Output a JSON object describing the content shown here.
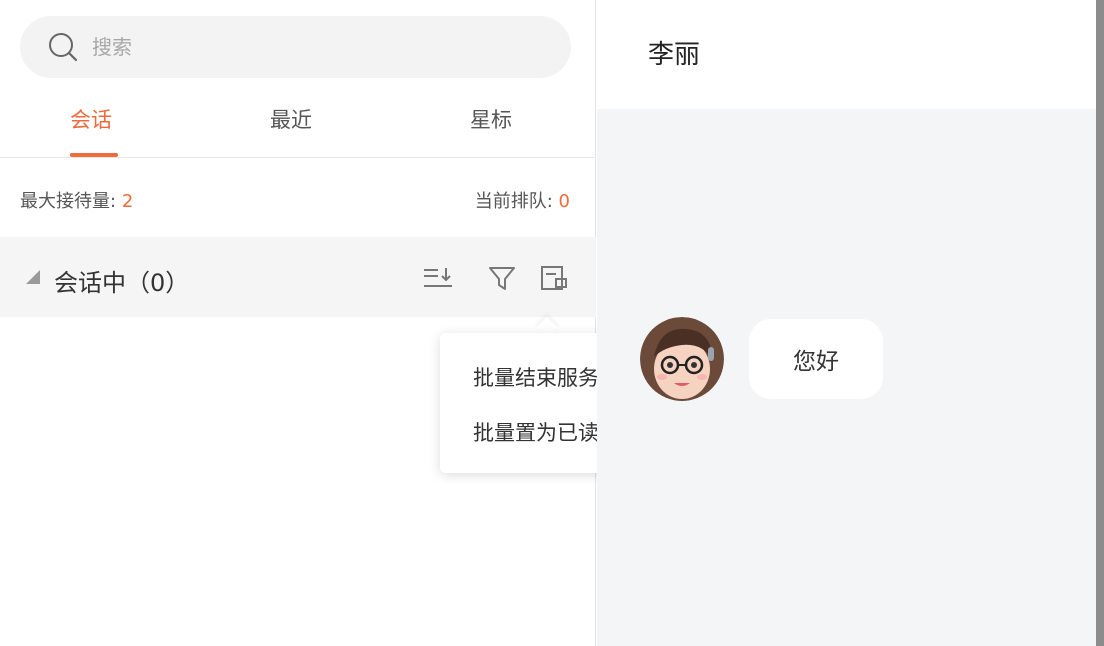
{
  "search": {
    "placeholder": "搜索"
  },
  "tabs": [
    {
      "label": "会话",
      "active": true
    },
    {
      "label": "最近",
      "active": false
    },
    {
      "label": "星标",
      "active": false
    }
  ],
  "stats": {
    "max_label": "最大接待量:",
    "max_value": "2",
    "queue_label": "当前排队:",
    "queue_value": "0"
  },
  "group": {
    "title": "会话中（0）"
  },
  "popover": {
    "items": [
      "批量结束服务",
      "批量置为已读"
    ]
  },
  "chat": {
    "contact_name": "李丽",
    "message": "您好"
  },
  "colors": {
    "accent": "#f06a3c",
    "panel_bg": "#f4f5f6",
    "group_bg": "#f5f5f5"
  },
  "icons": [
    "search-icon",
    "sort-icon",
    "filter-icon",
    "batch-icon"
  ]
}
